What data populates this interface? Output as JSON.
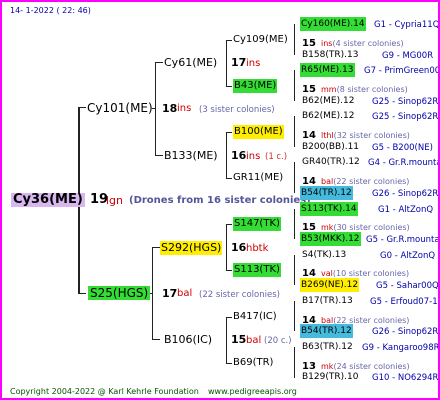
{
  "header": "14-   1-2022  ( 22: 46)",
  "footer": {
    "copyright": "Copyright 2004-2022 @ Karl Kehrle Foundation",
    "site": "www.pedigreeapis.org"
  },
  "root": {
    "name": "Cy36(ME)",
    "number": "19",
    "abbr": "lgn",
    "note": "(Drones from 16 sister colonies)"
  },
  "sire": {
    "name": "Cy101(ME)",
    "number": "18",
    "abbr": "ins",
    "note": "(3 sister colonies)"
  },
  "dam": {
    "name": "S25(HGS)",
    "number": "17",
    "abbr": "bal",
    "note": "(22 sister colonies)"
  },
  "gen3": [
    {
      "name": "Cy61(ME)",
      "number": "17",
      "abbr": "ins",
      "note": ""
    },
    {
      "name": "B133(ME)",
      "number": "16",
      "abbr": "ins",
      "note": "(1 c.)"
    },
    {
      "name": "S292(HGS)",
      "number": "16",
      "abbr": "hbtk",
      "note": ""
    },
    {
      "name": "B106(IC)",
      "number": "15",
      "abbr": "bal",
      "note": "(20 c.)"
    }
  ],
  "gen4": [
    {
      "name": "Cy109(ME)",
      "number": "15",
      "abbr": "ins",
      "note": "(4 sister colonies)"
    },
    {
      "name": "B43(ME)",
      "number": "15",
      "abbr": "mm",
      "note": "(8 sister colonies)"
    },
    {
      "name": "B100(ME)",
      "number": "14",
      "abbr": "lthl",
      "note": "(32 sister colonies)"
    },
    {
      "name": "GR11(ME)",
      "number": "14",
      "abbr": "bal",
      "note": "(22 sister colonies)"
    },
    {
      "name": "S147(TK)",
      "number": "15",
      "abbr": "mk",
      "note": "(30 sister colonies)"
    },
    {
      "name": "S113(TK)",
      "number": "14",
      "abbr": "val",
      "note": "(10 sister colonies)"
    },
    {
      "name": "B417(IC)",
      "number": "14",
      "abbr": "bal",
      "note": "(22 sister colonies)"
    },
    {
      "name": "B69(TR)",
      "number": "13",
      "abbr": "mk",
      "note": "(24 sister colonies)"
    }
  ],
  "gen5": [
    {
      "name": "Cy160(ME).14",
      "origin": "G1 - Cypria11Q"
    },
    {
      "name": "B158(TR).13",
      "origin": "G9 - MG00R"
    },
    {
      "name": "R65(ME).13",
      "origin": "G7 - PrimGreen00"
    },
    {
      "name": "B62(ME).12",
      "origin": "G25 - Sinop62R"
    },
    {
      "name": "B62(ME).12",
      "origin": "G25 - Sinop62R"
    },
    {
      "name": "B200(BB).11",
      "origin": "G5 - B200(NE)"
    },
    {
      "name": "GR40(TR).12",
      "origin": "G4 - Gr.R.mounta"
    },
    {
      "name": "B54(TR).12",
      "origin": "G26 - Sinop62R"
    },
    {
      "name": "S113(TK).14",
      "origin": "G1 - AltZonQ"
    },
    {
      "name": "B53(MKK).12",
      "origin": "G5 - Gr.R.mounta"
    },
    {
      "name": "S4(TK).13",
      "origin": "G0 - AltZonQ"
    },
    {
      "name": "B269(NE).12",
      "origin": "G5 - Sahar00Q"
    },
    {
      "name": "B17(TR).13",
      "origin": "G5 - Erfoud07-1Q"
    },
    {
      "name": "B54(TR).12",
      "origin": "G26 - Sinop62R"
    },
    {
      "name": "B63(TR).12",
      "origin": "G9 - Kangaroo98R"
    },
    {
      "name": "B129(TR).10",
      "origin": "G10 - NO6294R"
    }
  ],
  "colors": {
    "frame": "#ff00ff",
    "green": "#33dd33",
    "yellow": "#ffee00",
    "cyan": "#44bbdd",
    "violet": "#d8b6ee",
    "abbr_red": "#cc0000",
    "origin_blue": "#0000aa"
  }
}
